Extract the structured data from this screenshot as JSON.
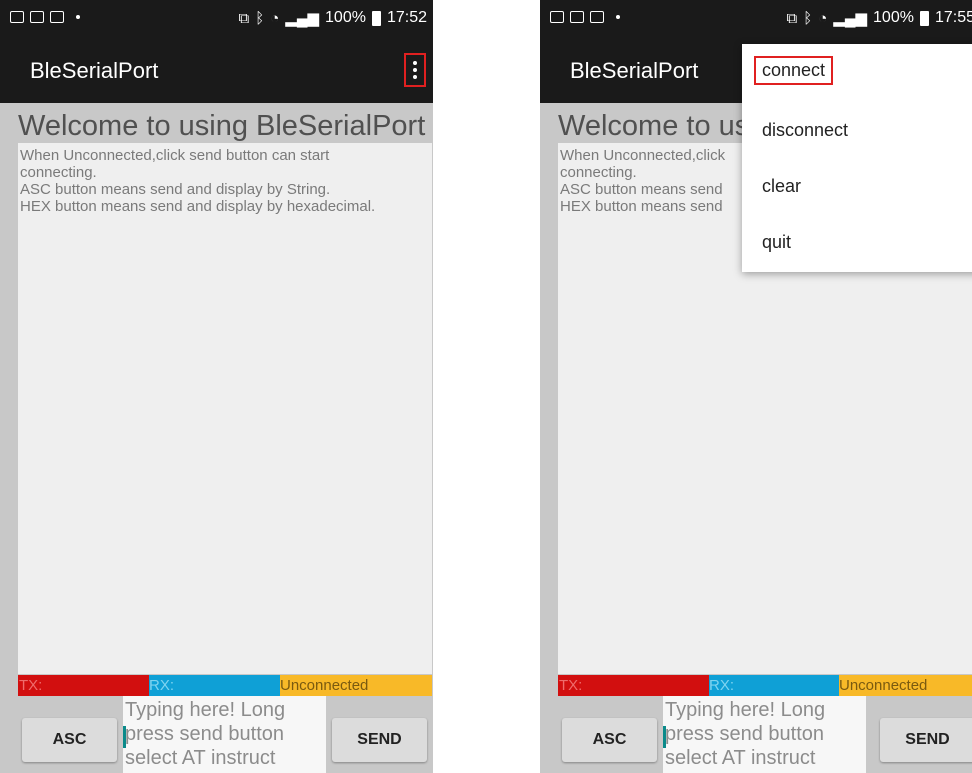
{
  "left": {
    "status": {
      "battery": "100%",
      "time": "17:52"
    },
    "app_title": "BleSerialPort",
    "welcome": "Welcome to using BleSerialPort",
    "log_lines": [
      "When Unconnected,click send button can start",
      "connecting.",
      " ASC button means send and display by String.",
      " HEX button means send and display by hexadecimal."
    ],
    "tx_label": "TX:",
    "rx_label": "RX:",
    "conn_status": "Unconnected",
    "asc_label": "ASC",
    "send_label": "SEND",
    "input_lines": [
      "Typing here! Long",
      "press send button",
      "select AT instruct"
    ]
  },
  "right": {
    "status": {
      "battery": "100%",
      "time": "17:55"
    },
    "app_title": "BleSerialPort",
    "welcome": "Welcome to us",
    "log_lines": [
      "When Unconnected,click",
      "connecting.",
      " ASC button means send",
      " HEX button means send"
    ],
    "tx_label": "TX:",
    "rx_label": "RX:",
    "conn_status": "Unconnected",
    "asc_label": "ASC",
    "send_label": "SEND",
    "input_lines": [
      "Typing here! Long",
      "press send button",
      "select AT instruct"
    ],
    "menu": [
      "connect",
      "disconnect",
      "clear",
      "quit"
    ]
  },
  "icons": {
    "overflow": "more-vertical-icon",
    "cast": "cast-icon",
    "bluetooth": "bluetooth-icon",
    "wifi": "wifi-icon",
    "signal": "signal-icon",
    "battery": "battery-icon"
  },
  "colors": {
    "tx": "#d20f0f",
    "rx": "#0fa0d6",
    "status": "#f8b928",
    "highlight": "#e02020"
  }
}
